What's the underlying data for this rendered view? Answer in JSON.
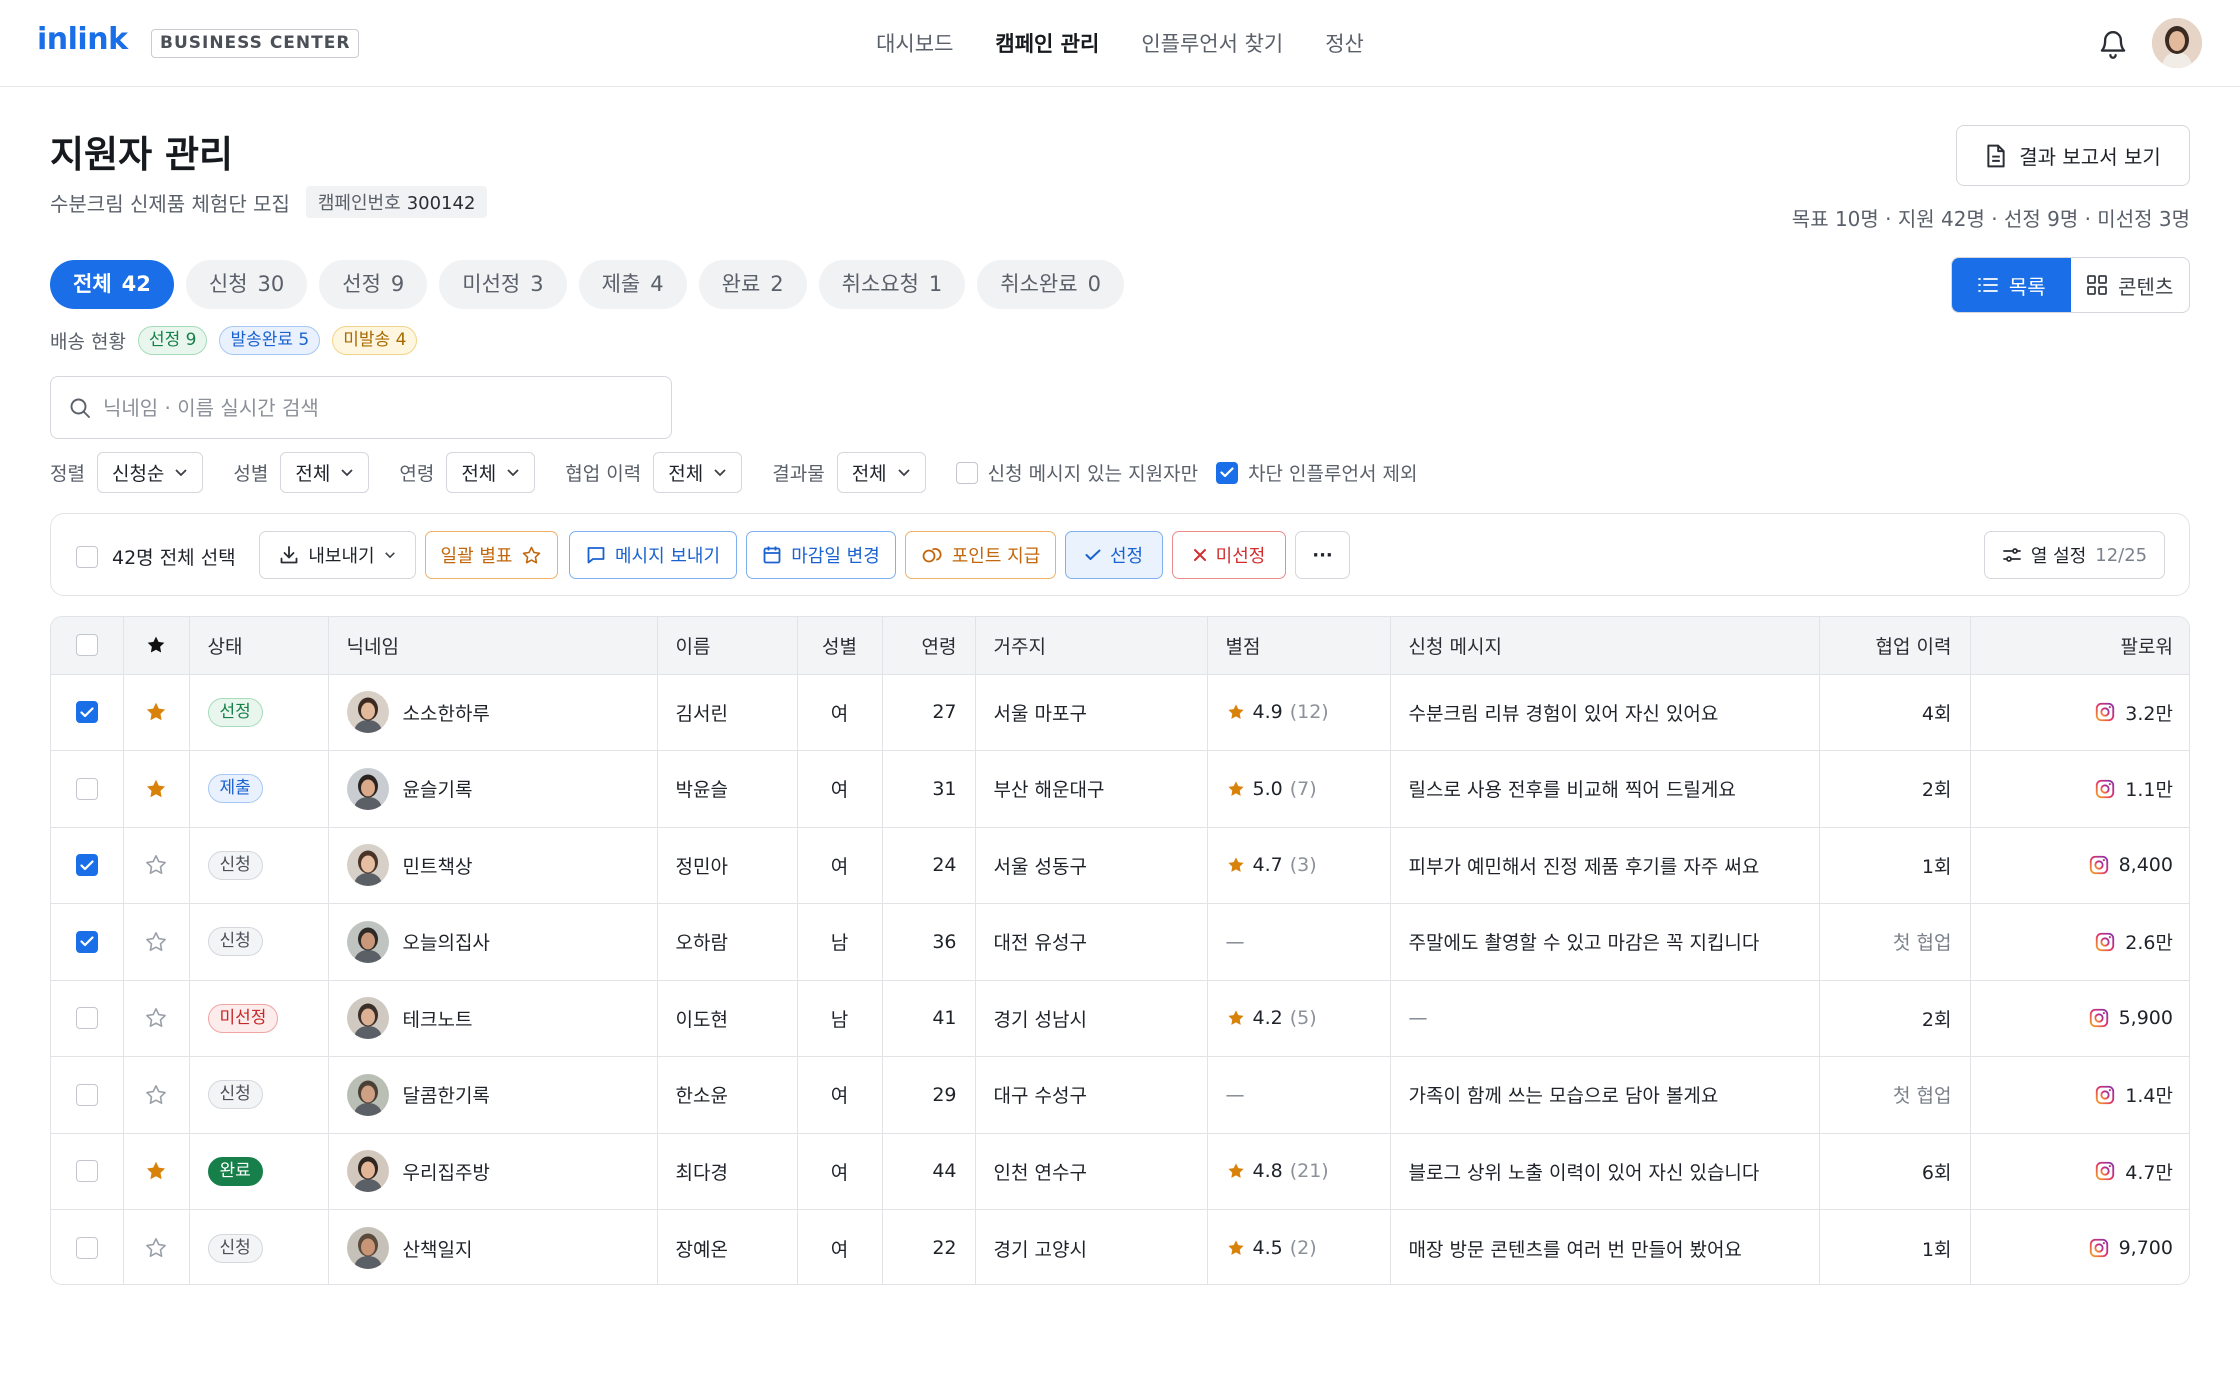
{
  "header": {
    "logo": "inlink",
    "badge": "BUSINESS CENTER",
    "nav": [
      "대시보드",
      "캠페인 관리",
      "인플루언서 찾기",
      "정산"
    ],
    "active_nav": 1
  },
  "page": {
    "title": "지원자 관리",
    "subtitle": "수분크림 신제품 체험단 모집",
    "campaign_label": "캠페인번호",
    "campaign_no": "300142",
    "report_button": "결과 보고서 보기",
    "summary": "목표 10명 · 지원 42명 · 선정 9명 · 미선정 3명"
  },
  "tabs": [
    {
      "label": "전체",
      "count": "42"
    },
    {
      "label": "신청",
      "count": "30"
    },
    {
      "label": "선정",
      "count": "9"
    },
    {
      "label": "미선정",
      "count": "3"
    },
    {
      "label": "제출",
      "count": "4"
    },
    {
      "label": "완료",
      "count": "2"
    },
    {
      "label": "취소요청",
      "count": "1"
    },
    {
      "label": "취소완료",
      "count": "0"
    }
  ],
  "view_toggle": {
    "list": "목록",
    "content": "콘텐츠"
  },
  "shipping": {
    "label": "배송 현황",
    "selected": "선정 9",
    "shipped": "발송완료 5",
    "unshipped": "미발송 4"
  },
  "search": {
    "placeholder": "닉네임 · 이름 실시간 검색"
  },
  "filters": {
    "sort_label": "정렬",
    "sort_value": "신청순",
    "gender_label": "성별",
    "gender_value": "전체",
    "age_label": "연령",
    "age_value": "전체",
    "history_label": "협업 이력",
    "history_value": "전체",
    "result_label": "결과물",
    "result_value": "전체",
    "msg_only": "신청 메시지 있는 지원자만",
    "exclude_blocked": "차단 인플루언서 제외"
  },
  "actions": {
    "select_all": "42명 전체 선택",
    "export": "내보내기",
    "bulk_star": "일괄 별표",
    "message": "메시지 보내기",
    "deadline": "마감일 변경",
    "points": "포인트 지급",
    "select": "선정",
    "reject": "미선정",
    "more": "···",
    "columns": "열 설정",
    "columns_count": "12/25"
  },
  "table": {
    "headers": {
      "status": "상태",
      "nickname": "닉네임",
      "name": "이름",
      "gender": "성별",
      "age": "연령",
      "region": "거주지",
      "rating": "별점",
      "message": "신청 메시지",
      "history": "협업 이력",
      "followers": "팔로워"
    },
    "rows": [
      {
        "checked": true,
        "starred": true,
        "status": "선정",
        "status_type": "sel",
        "nickname": "소소한하루",
        "name": "김서린",
        "gender": "여",
        "age": "27",
        "region": "서울 마포구",
        "rating": "4.9",
        "rating_count": "(12)",
        "message": "수분크림 리뷰 경험이 있어 자신 있어요",
        "history": "4회",
        "followers": "3.2만"
      },
      {
        "checked": false,
        "starred": true,
        "status": "제출",
        "status_type": "sub",
        "nickname": "윤슬기록",
        "name": "박윤슬",
        "gender": "여",
        "age": "31",
        "region": "부산 해운대구",
        "rating": "5.0",
        "rating_count": "(7)",
        "message": "릴스로 사용 전후를 비교해 찍어 드릴게요",
        "history": "2회",
        "followers": "1.1만"
      },
      {
        "checked": true,
        "starred": false,
        "status": "신청",
        "status_type": "app",
        "nickname": "민트책상",
        "name": "정민아",
        "gender": "여",
        "age": "24",
        "region": "서울 성동구",
        "rating": "4.7",
        "rating_count": "(3)",
        "message": "피부가 예민해서 진정 제품 후기를 자주 써요",
        "history": "1회",
        "followers": "8,400"
      },
      {
        "checked": true,
        "starred": false,
        "status": "신청",
        "status_type": "app",
        "nickname": "오늘의집사",
        "name": "오하람",
        "gender": "남",
        "age": "36",
        "region": "대전 유성구",
        "rating": "",
        "rating_count": "",
        "message": "주말에도 촬영할 수 있고 마감은 꼭 지킵니다",
        "history": "첫 협업",
        "followers": "2.6만"
      },
      {
        "checked": false,
        "starred": false,
        "status": "미선정",
        "status_type": "rej",
        "nickname": "테크노트",
        "name": "이도현",
        "gender": "남",
        "age": "41",
        "region": "경기 성남시",
        "rating": "4.2",
        "rating_count": "(5)",
        "message": "",
        "history": "2회",
        "followers": "5,900"
      },
      {
        "checked": false,
        "starred": false,
        "status": "신청",
        "status_type": "app",
        "nickname": "달콤한기록",
        "name": "한소윤",
        "gender": "여",
        "age": "29",
        "region": "대구 수성구",
        "rating": "",
        "rating_count": "",
        "message": "가족이 함께 쓰는 모습으로 담아 볼게요",
        "history": "첫 협업",
        "followers": "1.4만"
      },
      {
        "checked": false,
        "starred": true,
        "status": "완료",
        "status_type": "done",
        "nickname": "우리집주방",
        "name": "최다경",
        "gender": "여",
        "age": "44",
        "region": "인천 연수구",
        "rating": "4.8",
        "rating_count": "(21)",
        "message": "블로그 상위 노출 이력이 있어 자신 있습니다",
        "history": "6회",
        "followers": "4.7만"
      },
      {
        "checked": false,
        "starred": false,
        "status": "신청",
        "status_type": "app",
        "nickname": "산책일지",
        "name": "장예온",
        "gender": "여",
        "age": "22",
        "region": "경기 고양시",
        "rating": "4.5",
        "rating_count": "(2)",
        "message": "매장 방문 콘텐츠를 여러 번 만들어 봤어요",
        "history": "1회",
        "followers": "9,700"
      }
    ],
    "empty_mark": "—"
  }
}
